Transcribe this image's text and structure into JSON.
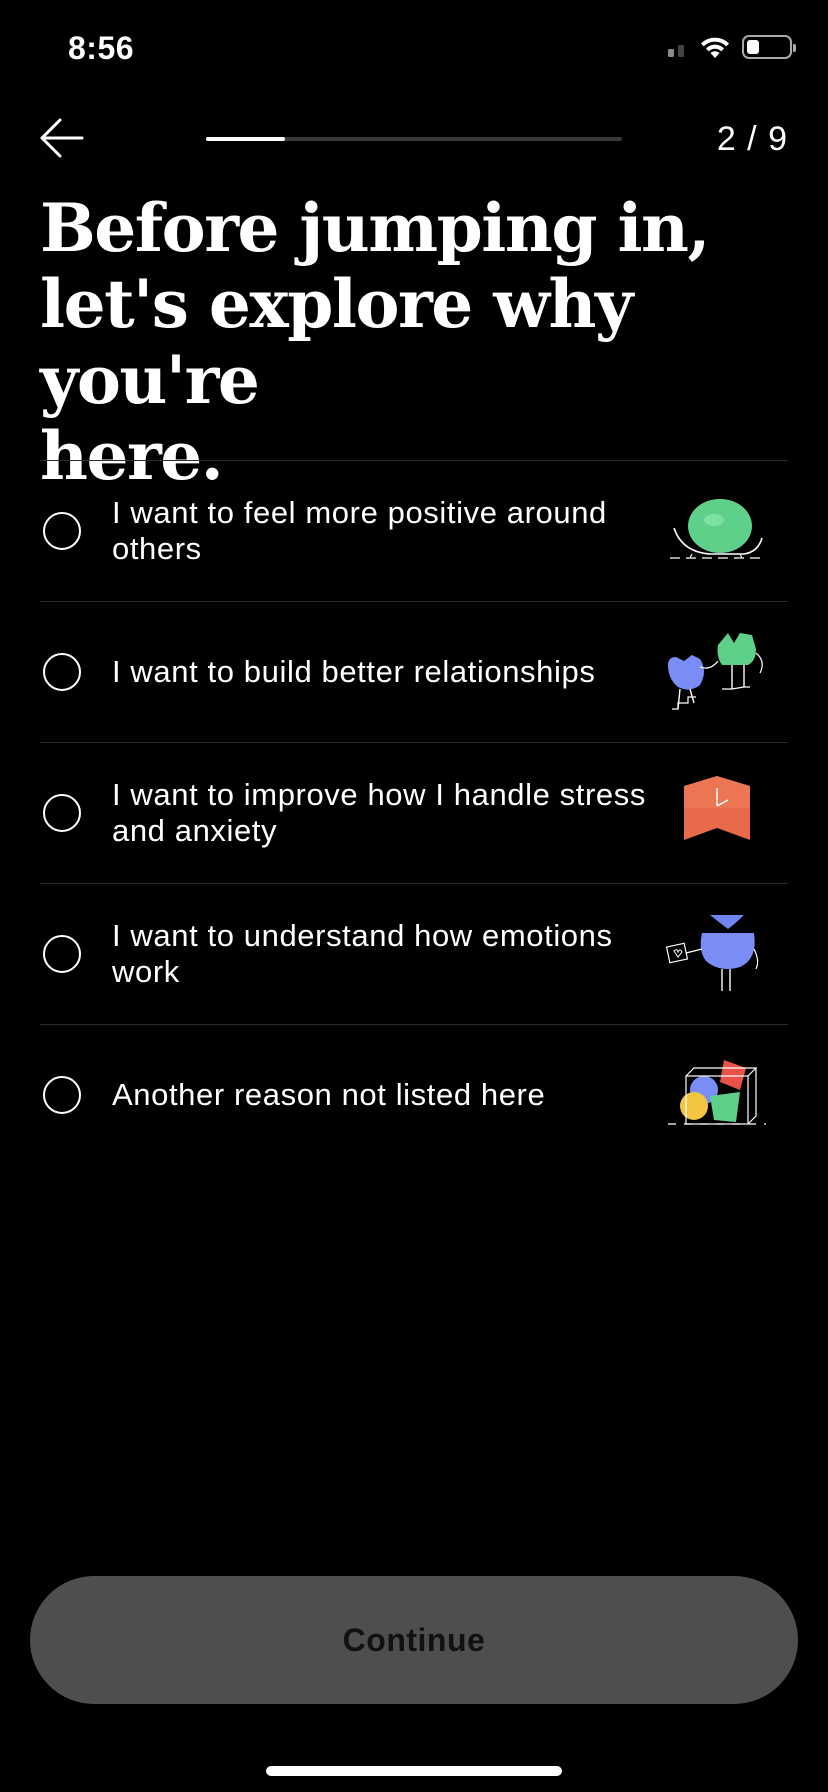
{
  "status_bar": {
    "time": "8:56"
  },
  "nav": {
    "back_icon": "arrow-left-icon",
    "step_counter": "2 / 9",
    "progress_fraction": 0.19
  },
  "title": "Before jumping in, let's explore why you're here.",
  "options": [
    {
      "label": "I want to feel more positive around others",
      "selected": false,
      "illustration": "green-blob-on-rocker-illustration"
    },
    {
      "label": "I want to build better relationships",
      "selected": false,
      "illustration": "two-characters-illustration"
    },
    {
      "label": "I want to improve how I handle stress and anxiety",
      "selected": false,
      "illustration": "clock-ribbon-illustration"
    },
    {
      "label": "I want to understand how emotions work",
      "selected": false,
      "illustration": "blue-character-with-heart-sign-illustration"
    },
    {
      "label": "Another reason not listed here",
      "selected": false,
      "illustration": "colorful-shapes-in-box-illustration"
    }
  ],
  "continue_button": {
    "label": "Continue",
    "enabled": false
  },
  "colors": {
    "background": "#000000",
    "text": "#ffffff",
    "button_disabled_bg": "#4e4e4e",
    "divider": "#2c2c2c",
    "progress_track": "#3a3a3a"
  }
}
